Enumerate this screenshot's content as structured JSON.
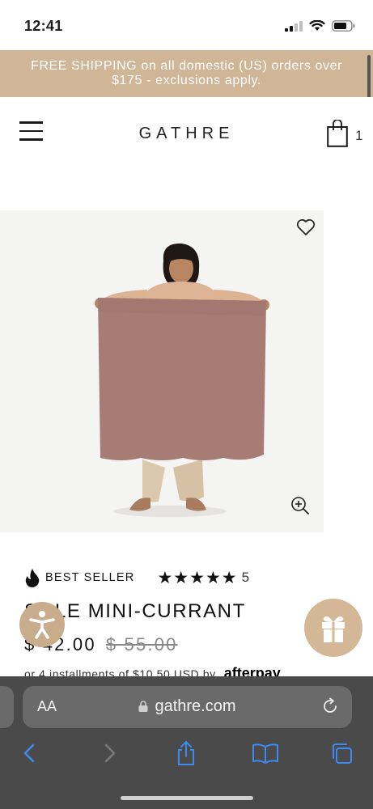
{
  "status_bar": {
    "time": "12:41"
  },
  "promo": {
    "text": "FREE SHIPPING on all domestic (US) orders over $175 - exclusions apply."
  },
  "header": {
    "logo": "GATHRE",
    "cart_count": "1"
  },
  "product": {
    "badge": "BEST SELLER",
    "rating": 5,
    "review_count": "5",
    "title": "SOLE MINI-CURRANT",
    "price": "$ 42.00",
    "compare_price": "$ 55.00",
    "installments_text": "or 4 installments of $10.50 USD by",
    "afterpay_logo": "afterpay",
    "blanket_color": "#a67c74"
  },
  "browser": {
    "aa_label": "AA",
    "url": "gathre.com"
  },
  "colors": {
    "promo_bg": "#d0b597",
    "accent_tan": "#d3b796",
    "browser_bg": "#4a4a4a",
    "ios_blue": "#3d8bf0"
  },
  "icons": {
    "menu": "hamburger-icon",
    "cart": "shopping-bag-icon",
    "wishlist": "heart-icon",
    "zoom": "zoom-in-icon",
    "badge": "flame-icon",
    "accessibility": "accessibility-icon",
    "gift": "gift-icon"
  }
}
